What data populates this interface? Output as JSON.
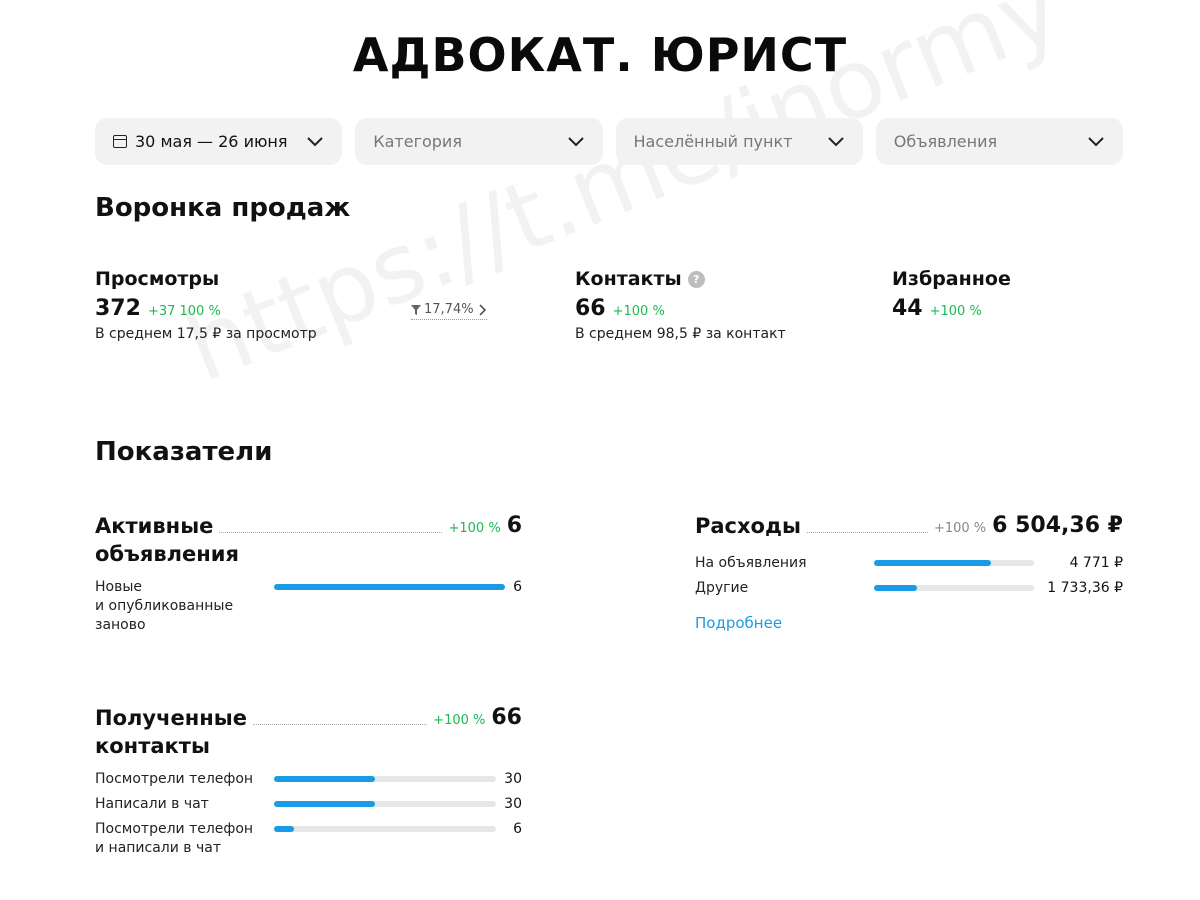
{
  "page_title": "АДВОКАТ. ЮРИСТ",
  "watermark": "https://t.me/inormy",
  "filters": {
    "period": "30 мая — 26 июня",
    "category": "Категория",
    "location": "Населённый пункт",
    "ads": "Объявления"
  },
  "funnel": {
    "title": "Воронка продаж",
    "views": {
      "label": "Просмотры",
      "value": "372",
      "delta": "+37 100 %",
      "sub": "В среднем 17,5 ₽ за просмотр",
      "conversion": "17,74%"
    },
    "contacts": {
      "label": "Контакты",
      "value": "66",
      "delta": "+100 %",
      "sub": "В среднем 98,5 ₽ за контакт"
    },
    "favorites": {
      "label": "Избранное",
      "value": "44",
      "delta": "+100 %"
    }
  },
  "metrics": {
    "title": "Показатели",
    "active_ads": {
      "title_line1": "Активные",
      "title_line2": "объявления",
      "delta": "+100 %",
      "total": "6",
      "rows": [
        {
          "label1": "Новые",
          "label2": "и опубликованные",
          "label3": "заново",
          "value": "6",
          "fraction": 1.0
        }
      ]
    },
    "received_contacts": {
      "title_line1": "Полученные",
      "title_line2": "контакты",
      "delta": "+100 %",
      "total": "66",
      "rows": [
        {
          "label1": "Посмотрели телефон",
          "label2": "",
          "value": "30",
          "fraction": 0.455
        },
        {
          "label1": "Написали в чат",
          "label2": "",
          "value": "30",
          "fraction": 0.455
        },
        {
          "label1": "Посмотрели телефон",
          "label2": "и написали в чат",
          "value": "6",
          "fraction": 0.09
        }
      ]
    },
    "expenses": {
      "title": "Расходы",
      "delta": "+100 %",
      "total": "6 504,36 ₽",
      "rows": [
        {
          "label": "На объявления",
          "value": "4 771 ₽",
          "fraction": 0.73
        },
        {
          "label": "Другие",
          "value": "1 733,36 ₽",
          "fraction": 0.27
        }
      ],
      "more_link": "Подробнее"
    }
  },
  "colors": {
    "accent": "#1a9be6",
    "positive": "#1db954",
    "filter_bg": "#f2f2f2",
    "track": "#e6e6e6"
  }
}
